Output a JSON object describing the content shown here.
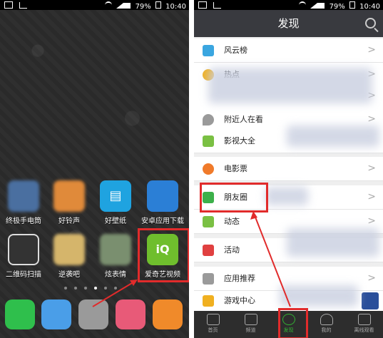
{
  "statusbar": {
    "battery": "79%",
    "time": "10:40"
  },
  "home": {
    "apps_row1": [
      {
        "label": "终极手电筒",
        "color": "#4a6fa0"
      },
      {
        "label": "好铃声",
        "color": "#e08a3a"
      },
      {
        "label": "好壁纸",
        "color": "#1fa3e0"
      },
      {
        "label": "安卓应用下载",
        "color": "#2b7fd6"
      }
    ],
    "apps_row2": [
      {
        "label": "二维码扫描",
        "color": "#333333"
      },
      {
        "label": "逆袭吧",
        "color": "#d5b56b"
      },
      {
        "label": "炫表情",
        "color": "#7a8f6f"
      },
      {
        "label": "爱奇艺视频",
        "color": "#6fbe2d"
      }
    ],
    "dock": [
      {
        "name": "phone",
        "color": "#2fbf4c"
      },
      {
        "name": "messages",
        "color": "#4a9ee8"
      },
      {
        "name": "settings",
        "color": "#9a9a9a"
      },
      {
        "name": "camera",
        "color": "#e85a78"
      },
      {
        "name": "uc-browser",
        "color": "#f08a2a"
      }
    ]
  },
  "discover": {
    "header_title": "发现",
    "rows": [
      {
        "label": "风云榜",
        "icon": "chart-icon",
        "color": "#3aa6e0"
      },
      {
        "label": "热点",
        "icon": "hot-icon",
        "color": "#f0b020"
      },
      {
        "label": "",
        "icon": "",
        "color": "#ffffff"
      },
      {
        "label": "附近人在看",
        "icon": "location-icon",
        "color": "#9a9a9a"
      },
      {
        "label": "影视大全",
        "icon": "film-icon",
        "color": "#7ac043"
      },
      {
        "label": "电影票",
        "icon": "ticket-icon",
        "color": "#f07a2a"
      },
      {
        "label": "朋友圈",
        "icon": "moments-icon",
        "color": "#3cb04a"
      },
      {
        "label": "动态",
        "icon": "feed-icon",
        "color": "#7ac043"
      },
      {
        "label": "活动",
        "icon": "gift-icon",
        "color": "#e04040"
      },
      {
        "label": "应用推荐",
        "icon": "apps-icon",
        "color": "#9a9a9a"
      },
      {
        "label": "游戏中心",
        "icon": "game-icon",
        "color": "#f0b020"
      }
    ],
    "tabs": [
      {
        "label": "首页",
        "icon": "home-icon"
      },
      {
        "label": "频道",
        "icon": "channel-icon"
      },
      {
        "label": "发现",
        "icon": "discover-icon"
      },
      {
        "label": "我的",
        "icon": "profile-icon"
      },
      {
        "label": "离线观看",
        "icon": "download-icon"
      }
    ]
  },
  "accent": {
    "highlight": "#e12b2b",
    "tab_active": "#33b333"
  }
}
